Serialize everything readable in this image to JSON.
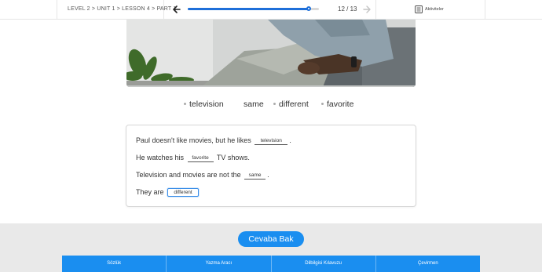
{
  "header": {
    "breadcrumb": "LEVEL 2 > UNIT 1 > LESSON 4 > PART 1",
    "progress_fraction": 0.92,
    "counter": "12 / 13",
    "activities_label": "Aktiviteler"
  },
  "word_bank": [
    "television",
    "same",
    "different",
    "favorite"
  ],
  "exercise": {
    "s1_before": "Paul doesn't like movies, but he likes",
    "s1_blank": "television",
    "s1_after": ".",
    "s2_before": "He watches his",
    "s2_blank": "favorite",
    "s2_after": "TV shows.",
    "s3_before": "Television and movies are not the",
    "s3_blank": "same",
    "s3_after": ".",
    "s4_before": "They are",
    "s4_blank": "different"
  },
  "answer_button": "Cevaba Bak",
  "tools": [
    "Sözlük",
    "Yazma Aracı",
    "Dilbilgisi Kılavuzu",
    "Çevirmen"
  ],
  "colors": {
    "accent": "#1a8ef0",
    "progress": "#1e6fd9"
  }
}
